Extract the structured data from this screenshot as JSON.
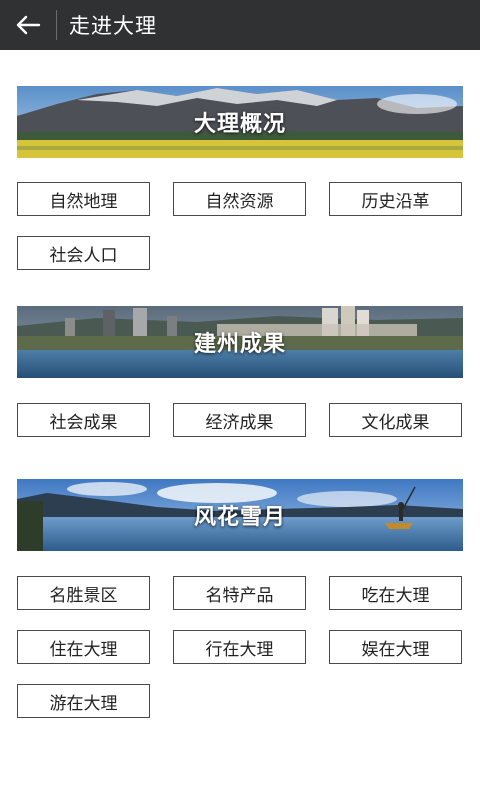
{
  "header": {
    "title": "走进大理"
  },
  "sections": [
    {
      "banner_label": "大理概况",
      "items": [
        "自然地理",
        "自然资源",
        "历史沿革",
        "社会人口"
      ]
    },
    {
      "banner_label": "建州成果",
      "items": [
        "社会成果",
        "经济成果",
        "文化成果"
      ]
    },
    {
      "banner_label": "风花雪月",
      "items": [
        "名胜景区",
        "名特产品",
        "吃在大理",
        "住在大理",
        "行在大理",
        "娱在大理",
        "游在大理"
      ]
    }
  ]
}
